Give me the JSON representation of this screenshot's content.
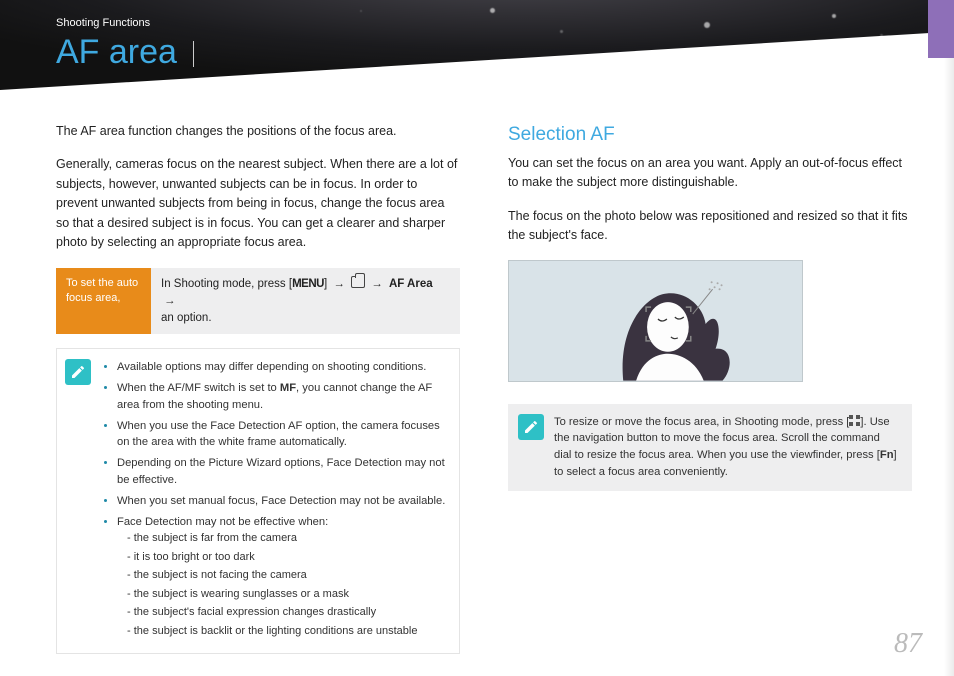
{
  "header": {
    "breadcrumb": "Shooting Functions",
    "title": "AF area"
  },
  "left": {
    "intro": "The AF area function changes the positions of the focus area.",
    "body": "Generally, cameras focus on the nearest subject. When there are a lot of subjects, however, unwanted subjects can be in focus. In order to prevent unwanted subjects from being in focus, change the focus area so that a desired subject is in focus. You can get a clearer and sharper photo by selecting an appropriate focus area.",
    "instruction": {
      "label": "To set the auto focus area,",
      "steps_prefix": "In Shooting mode, press [",
      "menu": "MENU",
      "steps_mid1": "] ",
      "arrow": "→",
      "af_area": "AF Area",
      "steps_suffix": " an option.",
      "mf": "MF"
    },
    "notes": {
      "items": [
        "Available options may differ depending on shooting conditions.",
        "When the AF/MF switch is set to MF, you cannot change the AF area from the shooting menu.",
        "When you use the Face Detection AF option, the camera focuses on the area with the white frame automatically.",
        "Depending on the Picture Wizard options, Face Detection may not be effective.",
        "When you set manual focus, Face Detection may not be available.",
        "Face Detection may not be effective when:"
      ],
      "subitems": [
        "the subject is far from the camera",
        "it is too bright or too dark",
        "the subject is not facing the camera",
        "the subject is wearing sunglasses or a mask",
        "the subject's facial expression changes drastically",
        "the subject is backlit or the lighting conditions are unstable"
      ]
    }
  },
  "right": {
    "heading": "Selection AF",
    "para1": "You can set the focus on an area you want. Apply an out-of-focus effect to make the subject more distinguishable.",
    "para2": "The focus on the photo below was repositioned and resized so that it fits the subject's face.",
    "tip": {
      "t1": "To resize or move the focus area, in Shooting mode, press [",
      "t2": "]. Use the navigation button to move the focus area. Scroll the command dial to resize the focus area. When you use the viewfinder, press [",
      "fn": "Fn",
      "t3": "] to select a focus area conveniently."
    }
  },
  "page_number": "87"
}
